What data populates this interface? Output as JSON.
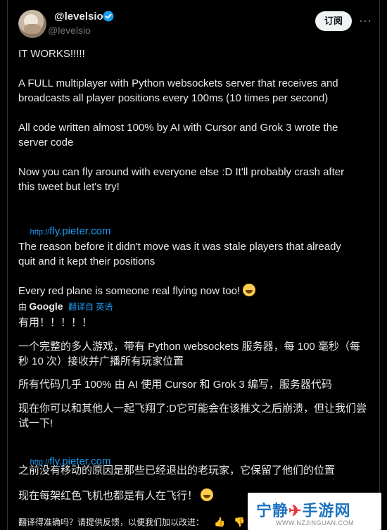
{
  "author": {
    "name": "@levelsio",
    "handle": "@levelsio"
  },
  "header": {
    "follow_label": "订阅",
    "more_icon": "more-icon"
  },
  "tweet": {
    "lines": [
      "IT WORKS!!!!!",
      "A FULL multiplayer with Python websockets server that receives and\nbroadcasts all player positions every 100ms (10 times per second)",
      "All code written almost 100% by AI with Cursor and Grok 3 wrote the\nserver code",
      "Now you can fly around with everyone else :D It'll probably crash after\nthis tweet but let's try!",
      "The reason before it didn't move was it was stale players that already\nquit and it kept their positions",
      "Every red plane is someone real flying now too!"
    ],
    "link_proto": "http://",
    "link_host": "fly.pieter.com"
  },
  "translation": {
    "by": "由",
    "provider": "Google",
    "translated_from": "翻译自 英语",
    "lines": [
      "有用！！！！！",
      "一个完整的多人游戏，带有 Python websockets 服务器，每 100 毫秒（每\n秒 10 次）接收并广播所有玩家位置",
      "所有代码几乎 100% 由 AI 使用 Cursor 和 Grok 3 编写，服务器代码",
      "现在你可以和其他人一起飞翔了:D它可能会在该推文之后崩溃，但让我们尝\n试一下!",
      "之前没有移动的原因是那些已经退出的老玩家，它保留了他们的位置",
      "现在每架红色飞机也都是有人在飞行！"
    ],
    "link_proto": "http://",
    "link_host": "fly.pieter.com",
    "feedback": "翻译得准确吗？请提供反馈，以便我们加以改进："
  },
  "watermark": {
    "title_part1": "宁静",
    "title_part2": "手游网",
    "url": "WWW.NZJINGUAN.COM"
  },
  "colors": {
    "background": "#000000",
    "text": "#e7e9ea",
    "secondary": "#71767b",
    "link": "#1d9bf0",
    "verified": "#1d9bf0"
  }
}
